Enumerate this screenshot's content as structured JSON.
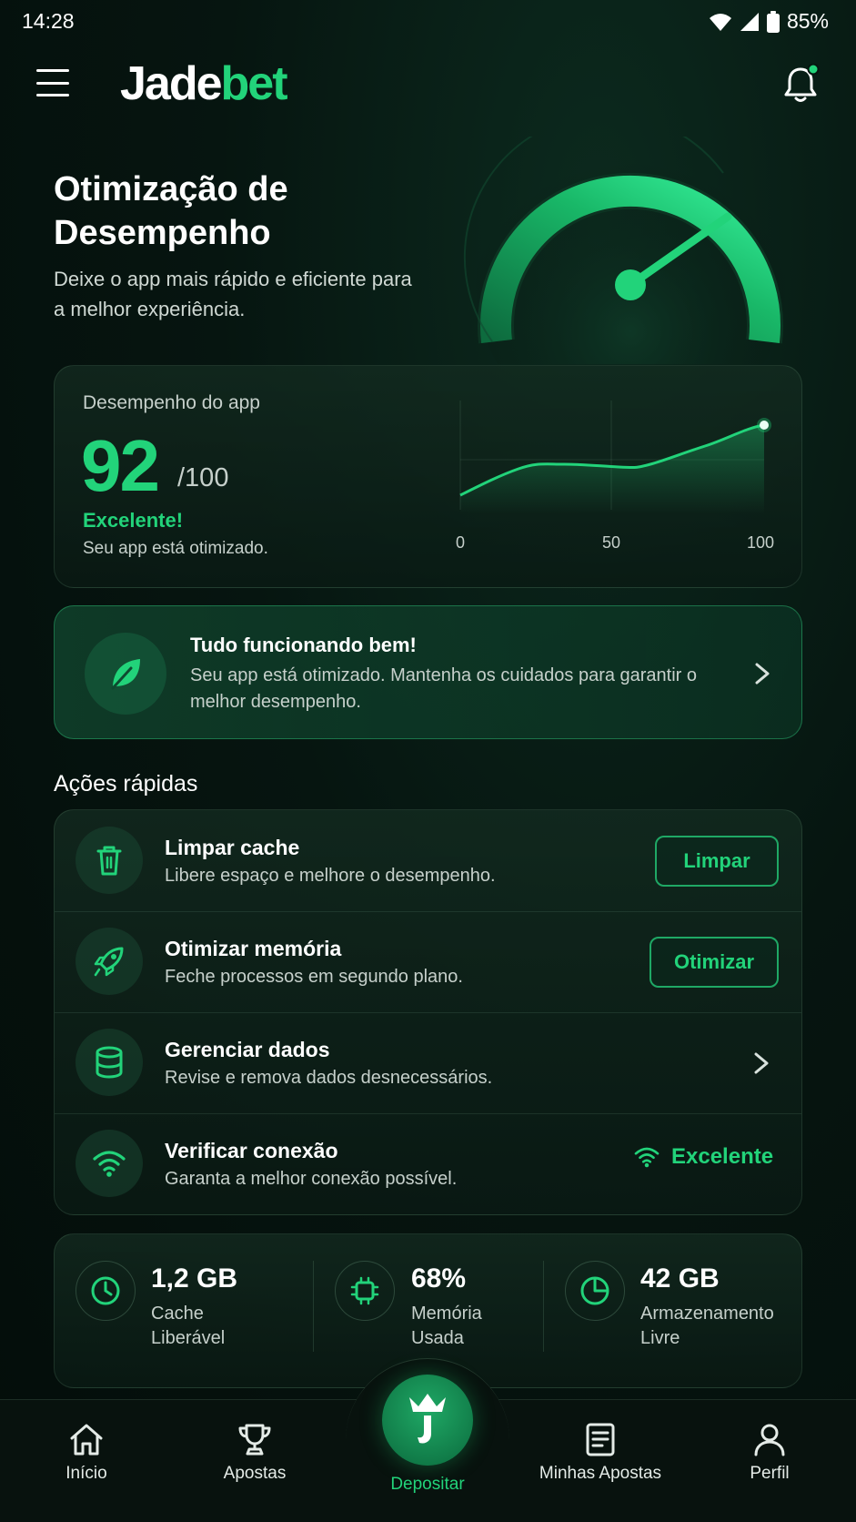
{
  "status_bar": {
    "time": "14:28",
    "battery": "85%"
  },
  "header": {
    "logo_part1": "Jade",
    "logo_part2": "bet"
  },
  "hero": {
    "title": "Otimização de Desempenho",
    "subtitle": "Deixe o app mais rápido e eficiente para a melhor experiência.",
    "gauge_level": 0.85
  },
  "performance": {
    "label": "Desempenho do app",
    "score": "92",
    "max": "/100",
    "status": "Excelente!",
    "description": "Seu app está otimizado.",
    "chart_ticks": [
      "0",
      "50",
      "100"
    ]
  },
  "notice": {
    "title": "Tudo funcionando bem!",
    "text": "Seu app está otimizado. Mantenha os cuidados para garantir o melhor desempenho."
  },
  "quick_actions": {
    "heading": "Ações rápidas",
    "items": [
      {
        "icon": "trash-icon",
        "title": "Limpar cache",
        "subtitle": "Libere espaço e melhore o desempenho.",
        "button": "Limpar"
      },
      {
        "icon": "rocket-icon",
        "title": "Otimizar memória",
        "subtitle": "Feche processos em segundo plano.",
        "button": "Otimizar"
      },
      {
        "icon": "database-icon",
        "title": "Gerenciar dados",
        "subtitle": "Revise e remova dados desnecessários."
      },
      {
        "icon": "wifi-icon",
        "title": "Verificar conexão",
        "subtitle": "Garanta a melhor conexão possível.",
        "status": "Excelente"
      }
    ]
  },
  "stats": [
    {
      "icon": "clock-icon",
      "value": "1,2 GB",
      "label_line1": "Cache",
      "label_line2": "Liberável"
    },
    {
      "icon": "chip-icon",
      "value": "68%",
      "label_line1": "Memória",
      "label_line2": "Usada"
    },
    {
      "icon": "pie-icon",
      "value": "42 GB",
      "label_line1": "Armazenamento",
      "label_line2": "Livre"
    }
  ],
  "bottom_nav": {
    "items": [
      {
        "icon": "home-icon",
        "label": "Início"
      },
      {
        "icon": "trophy-icon",
        "label": "Apostas"
      },
      {
        "icon": "crown-j-icon",
        "label": "Depositar"
      },
      {
        "icon": "document-icon",
        "label": "Minhas Apostas"
      },
      {
        "icon": "user-icon",
        "label": "Perfil"
      }
    ]
  },
  "colors": {
    "accent": "#22d37a",
    "background": "#061510",
    "card": "#10251b"
  }
}
